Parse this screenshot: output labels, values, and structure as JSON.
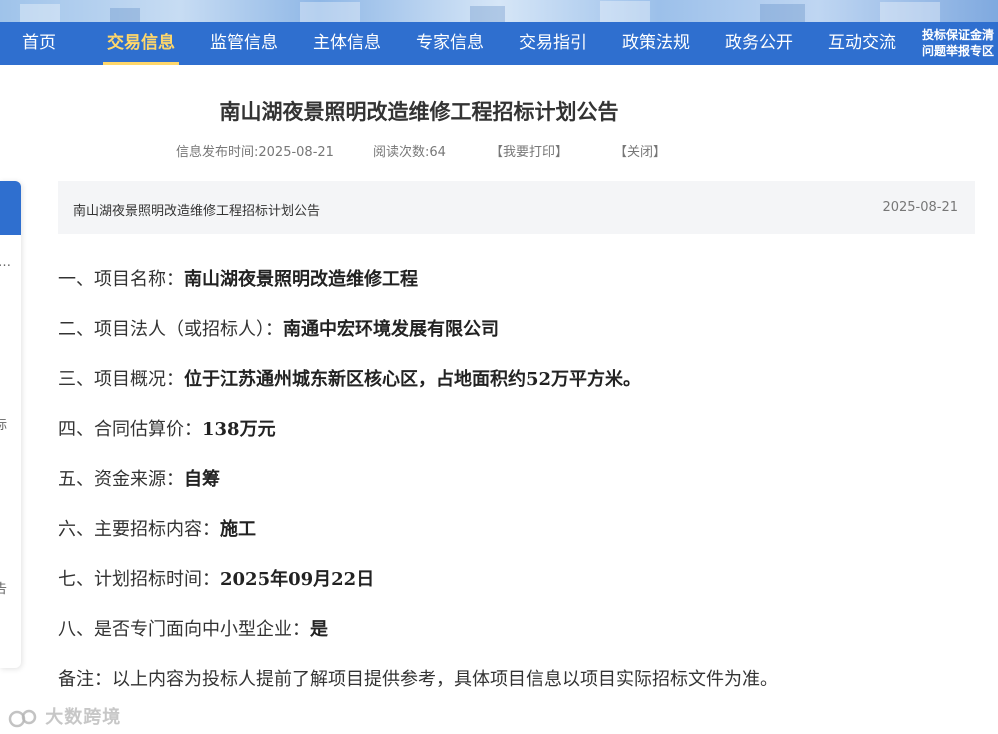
{
  "nav": {
    "items": [
      {
        "label": "首页",
        "active": false
      },
      {
        "label": "交易信息",
        "active": true
      },
      {
        "label": "监管信息",
        "active": false
      },
      {
        "label": "主体信息",
        "active": false
      },
      {
        "label": "专家信息",
        "active": false
      },
      {
        "label": "交易指引",
        "active": false
      },
      {
        "label": "政策法规",
        "active": false
      },
      {
        "label": "政务公开",
        "active": false
      },
      {
        "label": "互动交流",
        "active": false
      }
    ],
    "right_links": [
      "投标保证金清",
      "问题举报专区"
    ]
  },
  "left_panel": {
    "fragments": [
      "…",
      "标",
      "告"
    ]
  },
  "article": {
    "title": "南山湖夜景照明改造维修工程招标计划公告",
    "publish_time": "信息发布时间:2025-08-21",
    "read_count": "阅读次数:64",
    "print_label": "【我要打印】",
    "close_label": "【关闭】"
  },
  "info_bar": {
    "title": "南山湖夜景照明改造维修工程招标计划公告",
    "date": "2025-08-21"
  },
  "content": [
    {
      "label": "一、项目名称：",
      "value": "南山湖夜景照明改造维修工程"
    },
    {
      "label": "二、项目法人（或招标人）：",
      "value": "南通中宏环境发展有限公司"
    },
    {
      "label": "三、项目概况：",
      "value": "位于江苏通州城东新区核心区，占地面积约52万平方米。"
    },
    {
      "label": "四、合同估算价：",
      "value": "138万元"
    },
    {
      "label": "五、资金来源：",
      "value": "自筹"
    },
    {
      "label": "六、主要招标内容：",
      "value": "施工"
    },
    {
      "label": "七、计划招标时间：",
      "value": "2025年09月22日"
    },
    {
      "label": "八、是否专门面向中小型企业：",
      "value": "是"
    }
  ],
  "note": "备注：以上内容为投标人提前了解项目提供参考，具体项目信息以项目实际招标文件为准。",
  "watermark": "大数跨境"
}
